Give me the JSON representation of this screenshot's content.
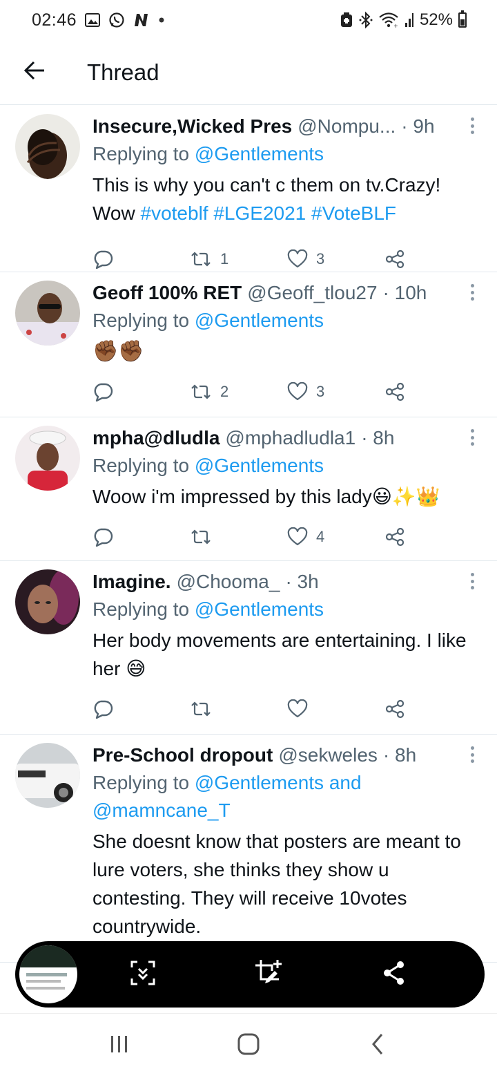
{
  "status_bar": {
    "time": "02:46",
    "battery": "52%",
    "icons": [
      "gallery-icon",
      "whatsapp-icon",
      "n-app-icon",
      "dot-icon",
      "battery-saver-icon",
      "bluetooth-icon",
      "wifi-icon",
      "signal-icon",
      "battery-icon"
    ]
  },
  "header": {
    "back_icon": "arrow-left-icon",
    "title": "Thread"
  },
  "colors": {
    "link": "#1d9bf0",
    "muted": "#536471",
    "text": "#0f1419"
  },
  "tweets": [
    {
      "name": "Insecure,Wicked Pres",
      "handle": "@Nompu...",
      "time": "· 9h",
      "replying_prefix": "Replying to",
      "replying_to": "@Gentlements",
      "text_lines": [
        "This is why you can't c them on tv.Crazy!"
      ],
      "text_prefix": "Wow",
      "hashtags": [
        "#voteblf",
        "#LGE2021",
        "#VoteBLF"
      ],
      "replies": "",
      "retweets": "1",
      "likes": "3"
    },
    {
      "name": "Geoff 100% RET",
      "handle": "@Geoff_tlou27",
      "time": "· 10h",
      "replying_prefix": "Replying to",
      "replying_to": "@Gentlements",
      "text": "✊🏾✊🏾",
      "retweets": "2",
      "likes": "3"
    },
    {
      "name": "mpha@dludla",
      "handle": "@mphadludla1",
      "time": "· 8h",
      "replying_prefix": "Replying to",
      "replying_to": "@Gentlements",
      "text": "Woow i'm impressed by this lady😃✨👑",
      "retweets": "",
      "likes": "4"
    },
    {
      "name": "Imagine.",
      "handle": "@Chooma_",
      "time": "· 3h",
      "replying_prefix": "Replying to",
      "replying_to": "@Gentlements",
      "text": "Her body movements are entertaining. I like her 😅",
      "retweets": "",
      "likes": ""
    },
    {
      "name": "Pre-School dropout",
      "handle": "@sekweles",
      "time": "· 8h",
      "replying_prefix": "Replying to",
      "replying_to": "@Gentlements and",
      "replying_to_2": "@mamncane_T",
      "text": "She doesnt know that posters are meant to lure voters, she thinks they show u contesting. They will receive 10votes countrywide."
    }
  ],
  "screenshot_toolbar": {
    "buttons": [
      "scroll-capture-icon",
      "crop-edit-icon",
      "share-icon"
    ]
  },
  "nav_bar": {
    "buttons": [
      "recents-icon",
      "home-icon",
      "back-icon"
    ]
  }
}
